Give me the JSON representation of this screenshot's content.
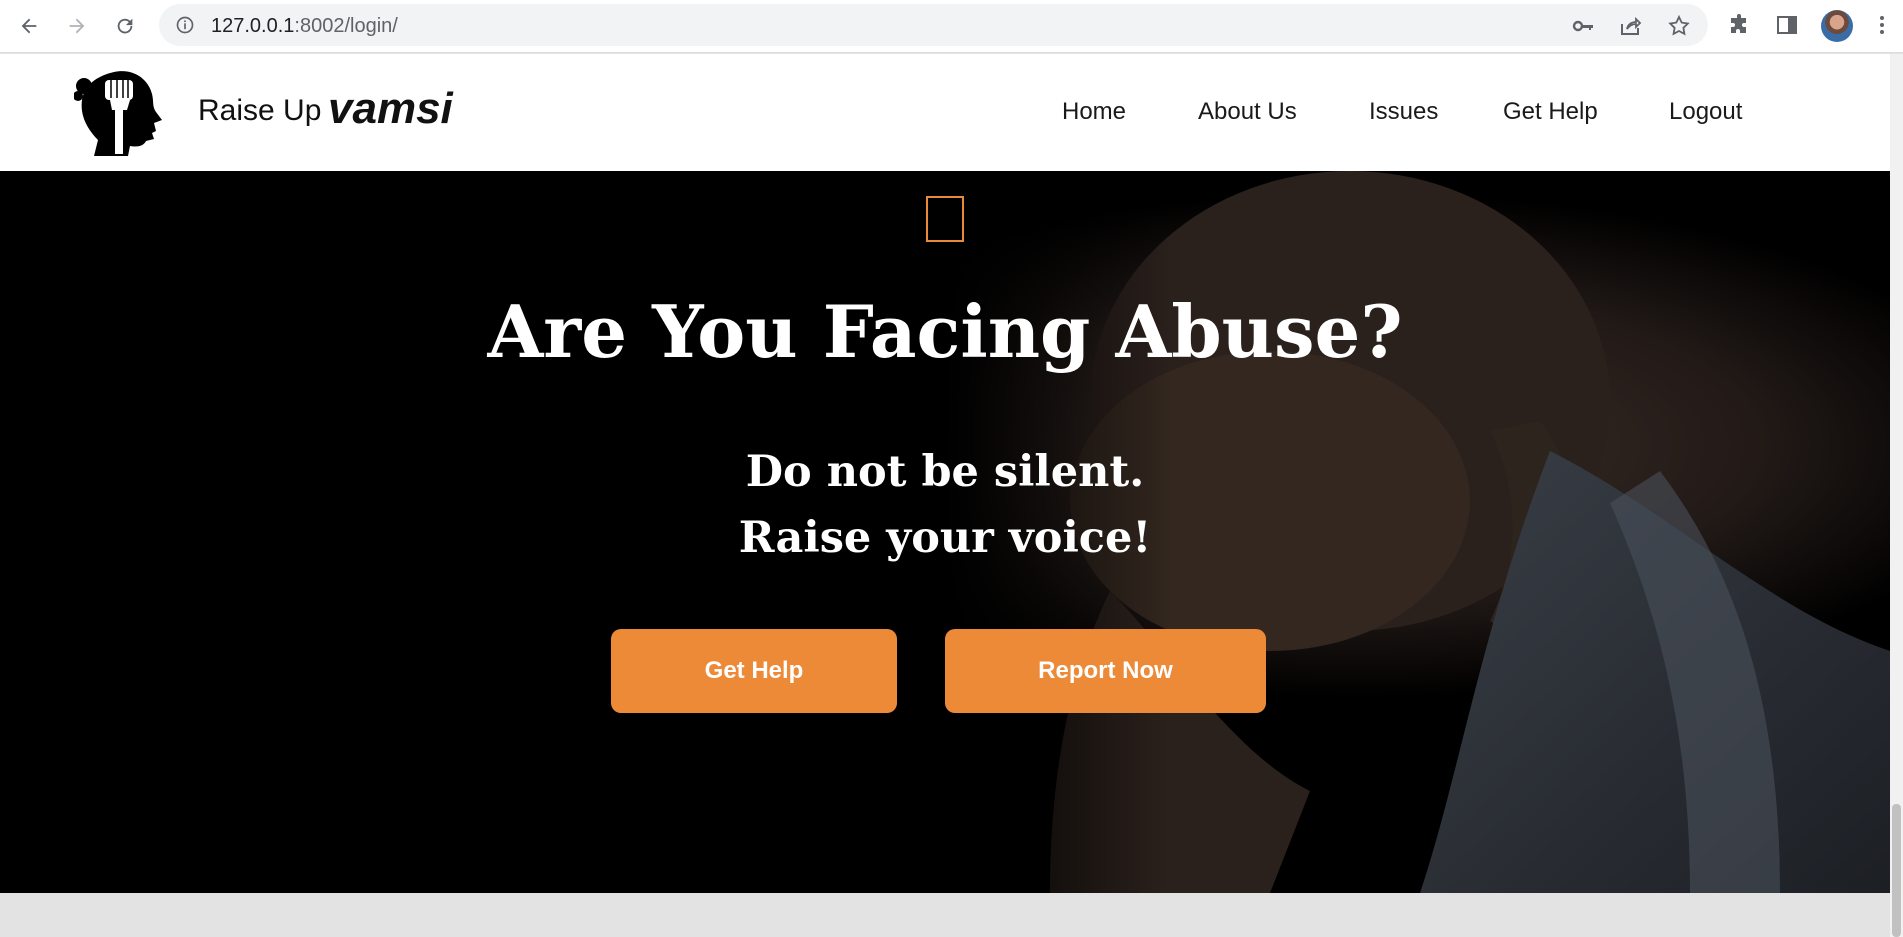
{
  "browser": {
    "url_host": "127.0.0.1",
    "url_rest": ":8002/login/",
    "icons": [
      "back-icon",
      "forward-icon",
      "reload-icon",
      "info-icon",
      "key-icon",
      "share-icon",
      "star-icon",
      "extensions-icon",
      "side-panel-icon",
      "menu-icon"
    ]
  },
  "header": {
    "brand": "Raise Up",
    "username": "vamsi",
    "nav": [
      "Home",
      "About Us",
      "Issues",
      "Get Help",
      "Logout"
    ]
  },
  "hero": {
    "title": "Are You Facing Abuse?",
    "line1": "Do not be silent.",
    "line2": "Raise your voice!",
    "buttons": [
      "Get Help",
      "Report Now"
    ]
  },
  "colors": {
    "accent": "#ec8a38",
    "hero_bg": "#000000",
    "page_bg": "#e3e3e3"
  }
}
